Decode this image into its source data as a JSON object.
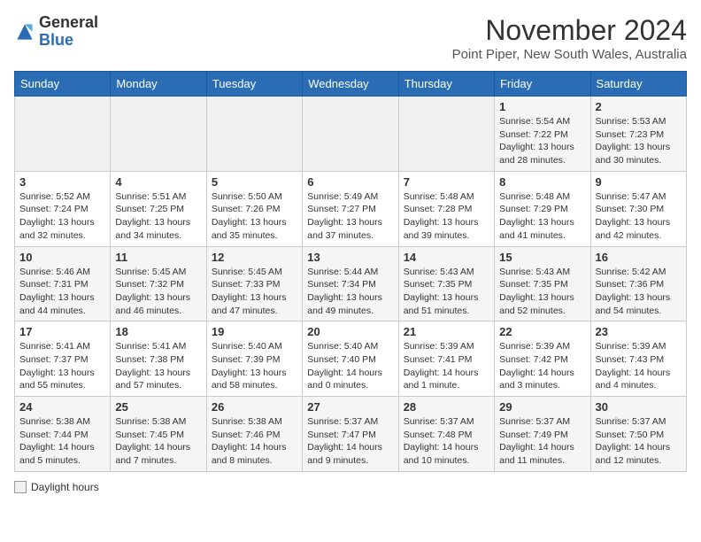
{
  "header": {
    "logo_general": "General",
    "logo_blue": "Blue",
    "month_title": "November 2024",
    "subtitle": "Point Piper, New South Wales, Australia"
  },
  "days_of_week": [
    "Sunday",
    "Monday",
    "Tuesday",
    "Wednesday",
    "Thursday",
    "Friday",
    "Saturday"
  ],
  "weeks": [
    {
      "days": [
        {
          "num": "",
          "info": ""
        },
        {
          "num": "",
          "info": ""
        },
        {
          "num": "",
          "info": ""
        },
        {
          "num": "",
          "info": ""
        },
        {
          "num": "",
          "info": ""
        },
        {
          "num": "1",
          "info": "Sunrise: 5:54 AM\nSunset: 7:22 PM\nDaylight: 13 hours and 28 minutes."
        },
        {
          "num": "2",
          "info": "Sunrise: 5:53 AM\nSunset: 7:23 PM\nDaylight: 13 hours and 30 minutes."
        }
      ]
    },
    {
      "days": [
        {
          "num": "3",
          "info": "Sunrise: 5:52 AM\nSunset: 7:24 PM\nDaylight: 13 hours and 32 minutes."
        },
        {
          "num": "4",
          "info": "Sunrise: 5:51 AM\nSunset: 7:25 PM\nDaylight: 13 hours and 34 minutes."
        },
        {
          "num": "5",
          "info": "Sunrise: 5:50 AM\nSunset: 7:26 PM\nDaylight: 13 hours and 35 minutes."
        },
        {
          "num": "6",
          "info": "Sunrise: 5:49 AM\nSunset: 7:27 PM\nDaylight: 13 hours and 37 minutes."
        },
        {
          "num": "7",
          "info": "Sunrise: 5:48 AM\nSunset: 7:28 PM\nDaylight: 13 hours and 39 minutes."
        },
        {
          "num": "8",
          "info": "Sunrise: 5:48 AM\nSunset: 7:29 PM\nDaylight: 13 hours and 41 minutes."
        },
        {
          "num": "9",
          "info": "Sunrise: 5:47 AM\nSunset: 7:30 PM\nDaylight: 13 hours and 42 minutes."
        }
      ]
    },
    {
      "days": [
        {
          "num": "10",
          "info": "Sunrise: 5:46 AM\nSunset: 7:31 PM\nDaylight: 13 hours and 44 minutes."
        },
        {
          "num": "11",
          "info": "Sunrise: 5:45 AM\nSunset: 7:32 PM\nDaylight: 13 hours and 46 minutes."
        },
        {
          "num": "12",
          "info": "Sunrise: 5:45 AM\nSunset: 7:33 PM\nDaylight: 13 hours and 47 minutes."
        },
        {
          "num": "13",
          "info": "Sunrise: 5:44 AM\nSunset: 7:34 PM\nDaylight: 13 hours and 49 minutes."
        },
        {
          "num": "14",
          "info": "Sunrise: 5:43 AM\nSunset: 7:35 PM\nDaylight: 13 hours and 51 minutes."
        },
        {
          "num": "15",
          "info": "Sunrise: 5:43 AM\nSunset: 7:35 PM\nDaylight: 13 hours and 52 minutes."
        },
        {
          "num": "16",
          "info": "Sunrise: 5:42 AM\nSunset: 7:36 PM\nDaylight: 13 hours and 54 minutes."
        }
      ]
    },
    {
      "days": [
        {
          "num": "17",
          "info": "Sunrise: 5:41 AM\nSunset: 7:37 PM\nDaylight: 13 hours and 55 minutes."
        },
        {
          "num": "18",
          "info": "Sunrise: 5:41 AM\nSunset: 7:38 PM\nDaylight: 13 hours and 57 minutes."
        },
        {
          "num": "19",
          "info": "Sunrise: 5:40 AM\nSunset: 7:39 PM\nDaylight: 13 hours and 58 minutes."
        },
        {
          "num": "20",
          "info": "Sunrise: 5:40 AM\nSunset: 7:40 PM\nDaylight: 14 hours and 0 minutes."
        },
        {
          "num": "21",
          "info": "Sunrise: 5:39 AM\nSunset: 7:41 PM\nDaylight: 14 hours and 1 minute."
        },
        {
          "num": "22",
          "info": "Sunrise: 5:39 AM\nSunset: 7:42 PM\nDaylight: 14 hours and 3 minutes."
        },
        {
          "num": "23",
          "info": "Sunrise: 5:39 AM\nSunset: 7:43 PM\nDaylight: 14 hours and 4 minutes."
        }
      ]
    },
    {
      "days": [
        {
          "num": "24",
          "info": "Sunrise: 5:38 AM\nSunset: 7:44 PM\nDaylight: 14 hours and 5 minutes."
        },
        {
          "num": "25",
          "info": "Sunrise: 5:38 AM\nSunset: 7:45 PM\nDaylight: 14 hours and 7 minutes."
        },
        {
          "num": "26",
          "info": "Sunrise: 5:38 AM\nSunset: 7:46 PM\nDaylight: 14 hours and 8 minutes."
        },
        {
          "num": "27",
          "info": "Sunrise: 5:37 AM\nSunset: 7:47 PM\nDaylight: 14 hours and 9 minutes."
        },
        {
          "num": "28",
          "info": "Sunrise: 5:37 AM\nSunset: 7:48 PM\nDaylight: 14 hours and 10 minutes."
        },
        {
          "num": "29",
          "info": "Sunrise: 5:37 AM\nSunset: 7:49 PM\nDaylight: 14 hours and 11 minutes."
        },
        {
          "num": "30",
          "info": "Sunrise: 5:37 AM\nSunset: 7:50 PM\nDaylight: 14 hours and 12 minutes."
        }
      ]
    }
  ],
  "footer": {
    "legend_label": "Daylight hours"
  }
}
